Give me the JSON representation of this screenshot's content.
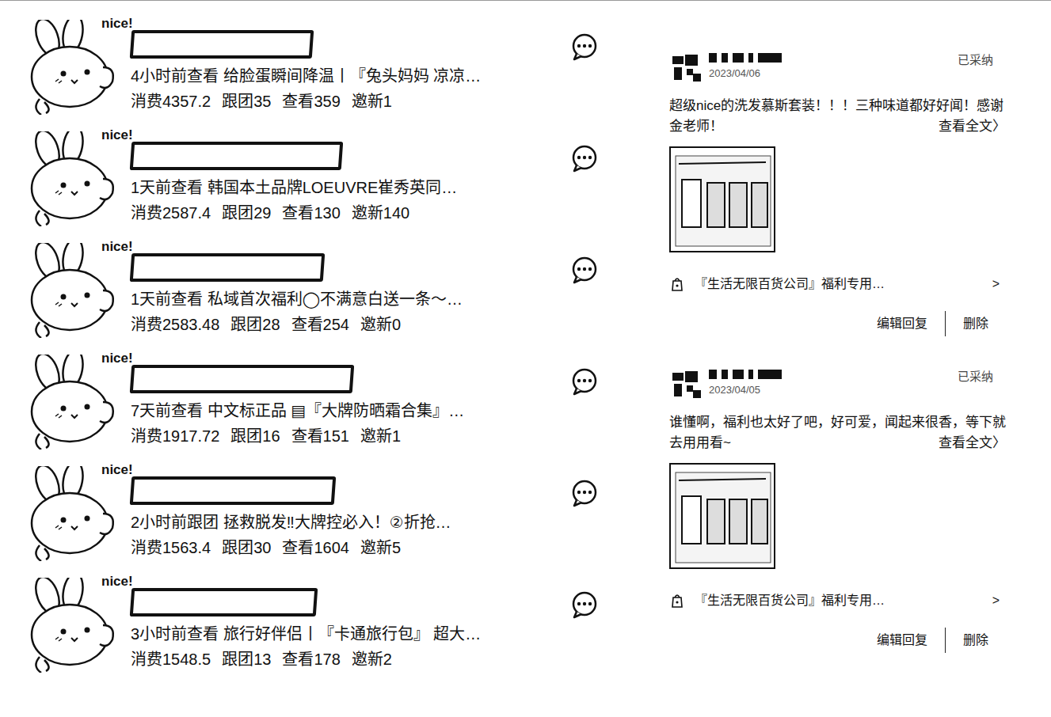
{
  "records": [
    {
      "sticker": "nice!",
      "time": "4小时前查看",
      "title": "给脸蛋瞬间降温丨『兔头妈妈 凉凉…",
      "stats": [
        {
          "label": "消费",
          "value": "4357.2"
        },
        {
          "label": "跟团",
          "value": "35"
        },
        {
          "label": "查看",
          "value": "359"
        },
        {
          "label": "邀新",
          "value": "1"
        }
      ]
    },
    {
      "sticker": "nice!",
      "time": "1天前查看",
      "title": "韩国本土品牌LOEUVRE崔秀英同…",
      "stats": [
        {
          "label": "消费",
          "value": "2587.4"
        },
        {
          "label": "跟团",
          "value": "29"
        },
        {
          "label": "查看",
          "value": "130"
        },
        {
          "label": "邀新",
          "value": "140"
        }
      ]
    },
    {
      "sticker": "nice!",
      "time": "1天前查看",
      "title": "私域首次福利◯不满意白送一条～…",
      "stats": [
        {
          "label": "消费",
          "value": "2583.48"
        },
        {
          "label": "跟团",
          "value": "28"
        },
        {
          "label": "查看",
          "value": "254"
        },
        {
          "label": "邀新",
          "value": "0"
        }
      ]
    },
    {
      "sticker": "nice!",
      "time": "7天前查看",
      "title": "中文标正品 ▤『大牌防晒霜合集』…",
      "stats": [
        {
          "label": "消费",
          "value": "1917.72"
        },
        {
          "label": "跟团",
          "value": "16"
        },
        {
          "label": "查看",
          "value": "151"
        },
        {
          "label": "邀新",
          "value": "1"
        }
      ]
    },
    {
      "sticker": "nice!",
      "time": "2小时前跟团",
      "title": "拯救脱发‼大牌控必入！②折抢…",
      "stats": [
        {
          "label": "消费",
          "value": "1563.4"
        },
        {
          "label": "跟团",
          "value": "30"
        },
        {
          "label": "查看",
          "value": "1604"
        },
        {
          "label": "邀新",
          "value": "5"
        }
      ]
    },
    {
      "sticker": "nice!",
      "time": "3小时前查看",
      "title": "旅行好伴侣丨『卡通旅行包』 超大…",
      "stats": [
        {
          "label": "消费",
          "value": "1548.5"
        },
        {
          "label": "跟团",
          "value": "13"
        },
        {
          "label": "查看",
          "value": "178"
        },
        {
          "label": "邀新",
          "value": "2"
        }
      ]
    }
  ],
  "comments": [
    {
      "date": "2023/04/06",
      "status": "已采纳",
      "text": "超级nice的洗发慕斯套装！！！三种味道都好好闻！感谢金老师！",
      "more": "查看全文〉",
      "link": "『生活无限百货公司』福利专用…",
      "link_arrow": ">",
      "buttons": [
        "编辑回复",
        "删除"
      ]
    },
    {
      "date": "2023/04/05",
      "status": "已采纳",
      "text": "谁懂啊，福利也太好了吧，好可爱，闻起来很香，等下就去用用看~",
      "more": "查看全文〉",
      "link": "『生活无限百货公司』福利专用…",
      "link_arrow": ">",
      "buttons": [
        "编辑回复",
        "删除"
      ]
    }
  ]
}
